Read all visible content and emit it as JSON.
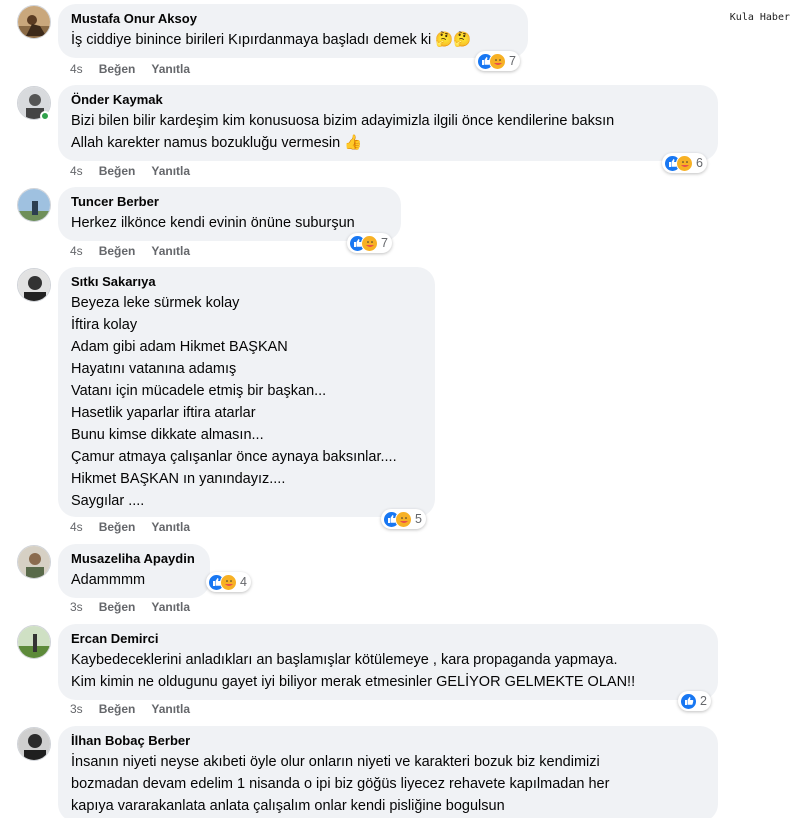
{
  "watermark": "Kula Haber",
  "comments": [
    {
      "author": "Mustafa Onur Aksoy",
      "text": "İş ciddiye binince birileri Kıpırdanmaya başladı demek ki 🤔🤔",
      "time": "4s",
      "like_label": "Beğen",
      "reply_label": "Yanıtla",
      "reaction_icons": [
        "like-icon",
        "care-icon"
      ],
      "reaction_count": "7"
    },
    {
      "author": "Önder Kaymak",
      "text": "Bizi bilen bilir kardeşim kim konusuosa bizim adayimizla ilgili önce kendilerine baksın\nAllah karekter namus bozukluğu vermesin 👍",
      "time": "4s",
      "like_label": "Beğen",
      "reply_label": "Yanıtla",
      "reaction_icons": [
        "like-icon",
        "care-icon"
      ],
      "reaction_count": "6",
      "online": true
    },
    {
      "author": "Tuncer Berber",
      "text": "Herkez ilkönce kendi evinin önüne suburşun",
      "time": "4s",
      "like_label": "Beğen",
      "reply_label": "Yanıtla",
      "reaction_icons": [
        "like-icon",
        "care-icon"
      ],
      "reaction_count": "7"
    },
    {
      "author": "Sıtkı Sakarıya",
      "text": "Beyeza leke sürmek kolay\nİftira kolay\nAdam gibi adam Hikmet BAŞKAN\nHayatını vatanına adamış\nVatanı için mücadele etmiş bir başkan...\nHasetlik yaparlar iftira atarlar\nBunu kimse dikkate almasın...\nÇamur atmaya çalışanlar önce aynaya baksınlar....\nHikmet BAŞKAN ın yanındayız....\nSaygılar ....",
      "time": "4s",
      "like_label": "Beğen",
      "reply_label": "Yanıtla",
      "reaction_icons": [
        "like-icon",
        "care-icon"
      ],
      "reaction_count": "5"
    },
    {
      "author": "Musazeliha Apaydin",
      "text": "Adammmm",
      "time": "3s",
      "like_label": "Beğen",
      "reply_label": "Yanıtla",
      "reaction_icons": [
        "like-icon",
        "care-icon"
      ],
      "reaction_count": "4"
    },
    {
      "author": "Ercan Demirci",
      "text": "Kaybedeceklerini anladıkları an başlamışlar kötülemeye , kara propaganda yapmaya.\nKim kimin ne oldugunu gayet iyi biliyor merak etmesinler GELİYOR GELMEKTE OLAN!!",
      "time": "3s",
      "like_label": "Beğen",
      "reply_label": "Yanıtla",
      "reaction_icons": [
        "like-icon"
      ],
      "reaction_count": "2"
    },
    {
      "author": "İlhan Bobaç Berber",
      "text": "İnsanın niyeti neyse akıbeti öyle olur onların niyeti ve karakteri bozuk biz kendimizi\nbozmadan devam edelim 1 nisanda o ipi biz göğüs liyecez rehavete kapılmadan her\nkapıya vararakanlata anlata çalışalım onlar kendi pisliğine bogulsun"
    }
  ],
  "colors": {
    "bubble": "#f0f2f5",
    "like_blue": "#1877f2",
    "care_yellow": "#f7b125",
    "meta_gray": "#65676b",
    "online_green": "#31a24c"
  }
}
